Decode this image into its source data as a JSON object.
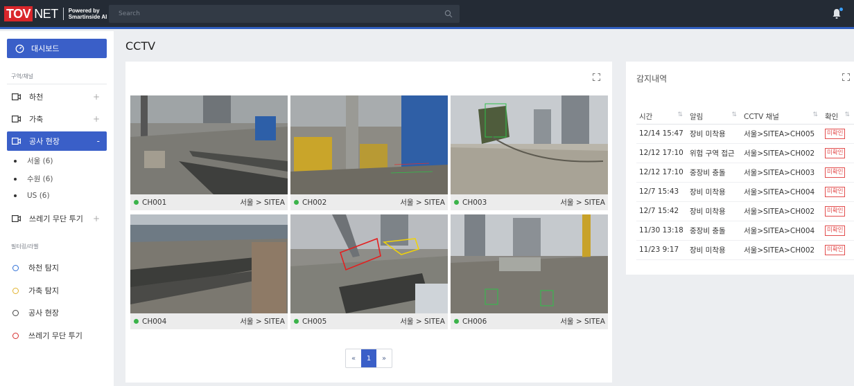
{
  "header": {
    "logo_red": "TOV",
    "logo_white": "NET",
    "powered_line1": "Powered by",
    "powered_line2": "Smartinside AI",
    "search_placeholder": "Search"
  },
  "sidebar": {
    "dashboard_label": "대시보드",
    "section_zone": "구역/채널",
    "items": [
      {
        "label": "하천",
        "state": "+"
      },
      {
        "label": "가축",
        "state": "+"
      },
      {
        "label": "공사 현장",
        "state": "-"
      },
      {
        "label": "쓰레기 무단 투기",
        "state": "+"
      }
    ],
    "subitems": [
      "서울 (6)",
      "수원 (6)",
      "US (6)"
    ],
    "section_filter": "필터링/라벨",
    "filters": [
      {
        "label": "하천 탐지",
        "color": "#2f6fd6"
      },
      {
        "label": "가축 탐지",
        "color": "#e2b22d"
      },
      {
        "label": "공사 현장",
        "color": "#444444"
      },
      {
        "label": "쓰레기 무단 투기",
        "color": "#d62f2f"
      }
    ]
  },
  "main": {
    "title": "CCTV",
    "cameras": [
      {
        "name": "CH001",
        "location": "서울 > SITEA"
      },
      {
        "name": "CH002",
        "location": "서울 > SITEA"
      },
      {
        "name": "CH003",
        "location": "서울 > SITEA"
      },
      {
        "name": "CH004",
        "location": "서울 > SITEA"
      },
      {
        "name": "CH005",
        "location": "서울 > SITEA"
      },
      {
        "name": "CH006",
        "location": "서울 > SITEA"
      }
    ],
    "pager": {
      "prev": "«",
      "current": "1",
      "next": "»"
    }
  },
  "detections": {
    "title": "감지내역",
    "columns": [
      "시간",
      "알림",
      "CCTV 채널",
      "확인"
    ],
    "rows": [
      {
        "time": "12/14 15:47",
        "alert": "장비 미착용",
        "channel": "서울>SITEA>CH005",
        "status": "미확인"
      },
      {
        "time": "12/12 17:10",
        "alert": "위험 구역 접근",
        "channel": "서울>SITEA>CH002",
        "status": "미확인"
      },
      {
        "time": "12/12 17:10",
        "alert": "중장비 충돌",
        "channel": "서울>SITEA>CH003",
        "status": "미확인"
      },
      {
        "time": "12/7 15:43",
        "alert": "장비 미착용",
        "channel": "서울>SITEA>CH004",
        "status": "미확인"
      },
      {
        "time": "12/7 15:42",
        "alert": "장비 미착용",
        "channel": "서울>SITEA>CH002",
        "status": "미확인"
      },
      {
        "time": "11/30 13:18",
        "alert": "중장비 충돌",
        "channel": "서울>SITEA>CH004",
        "status": "미확인"
      },
      {
        "time": "11/23 9:17",
        "alert": "장비 미착용",
        "channel": "서울>SITEA>CH002",
        "status": "미확인"
      }
    ]
  },
  "colors": {
    "accent": "#3a5fc8",
    "topbar": "#242b35",
    "live": "#3bb34a",
    "alert": "#e24c4c"
  }
}
